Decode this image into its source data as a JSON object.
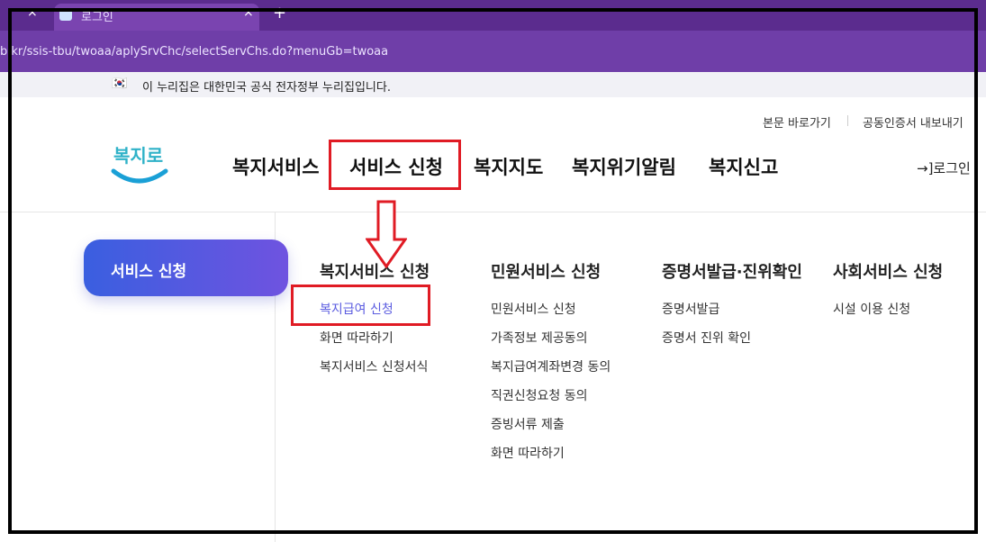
{
  "browser": {
    "tab_close_left": "×",
    "tab_title": "로그인",
    "tab_close": "×",
    "new_tab": "+",
    "url": "b.kr/ssis-tbu/twoaa/aplySrvChc/selectServChs.do?menuGb=twoaa"
  },
  "gov_notice": {
    "flag": "🇰🇷",
    "text": "이 누리집은 대한민국 공식 전자정부 누리집입니다."
  },
  "header": {
    "utils": [
      "본문 바로가기",
      "공동인증서 내보내기"
    ],
    "logo_text": "복지로",
    "nav": [
      "복지서비스",
      "서비스 신청",
      "복지지도",
      "복지위기알림",
      "복지신고"
    ],
    "login_icon": "→]",
    "login": "로그인"
  },
  "menu": {
    "side_button": "서비스 신청",
    "columns": [
      {
        "title": "복지서비스 신청",
        "items": [
          "복지급여 신청",
          "화면 따라하기",
          "복지서비스 신청서식"
        ]
      },
      {
        "title": "민원서비스 신청",
        "items": [
          "민원서비스 신청",
          "가족정보 제공동의",
          "복지급여계좌변경 동의",
          "직권신청요청 동의",
          "증빙서류 제출",
          "화면 따라하기"
        ]
      },
      {
        "title": "증명서발급·진위확인",
        "items": [
          "증명서발급",
          "증명서 진위 확인"
        ]
      },
      {
        "title": "사회서비스 신청",
        "items": [
          "시설 이용 신청"
        ]
      }
    ]
  },
  "colors": {
    "accent": "#5b5ce0",
    "annotation": "#e01b24",
    "brand_purple": "#5b2c8e"
  }
}
